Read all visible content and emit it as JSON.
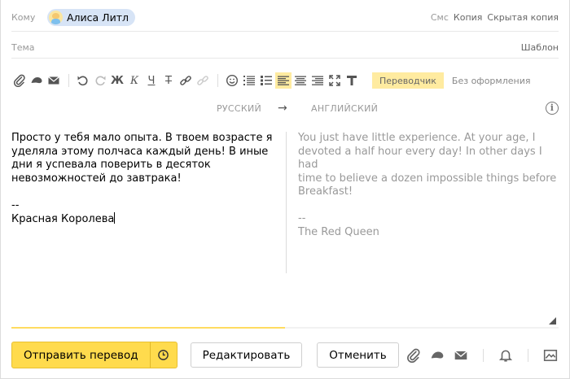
{
  "recipients": {
    "to_label": "Кому",
    "recipient_name": "Алиса Литл",
    "sms": "Смс",
    "cc": "Копия",
    "bcc": "Скрытая копия"
  },
  "subject": {
    "label": "Тема",
    "template_link": "Шаблон"
  },
  "toolbar": {
    "bold": "Ж",
    "italic": "К",
    "underline": "Ч",
    "strike": "Т",
    "translator": "Переводчик",
    "no_format": "Без оформления"
  },
  "translation": {
    "source_lang": "РУССКИЙ",
    "arrow": "→",
    "target_lang": "АНГЛИЙСКИЙ",
    "info": "i",
    "source_text": "Просто у тебя мало опыта. В твоем возрасте я\nуделяла этому полчаса каждый день! В иные\nдни я успевала поверить в десяток\nневозможностей до завтрака!\n\n--\nКрасная Королева",
    "target_text": "You just have little experience. At your age, I\ndevoted a half hour every day! In other days I had\ntime to believe a dozen impossible things before\nBreakfast!\n\n--\nThe Red Queen",
    "progress": 0.5
  },
  "actions": {
    "send": "Отправить перевод",
    "edit": "Редактировать",
    "cancel": "Отменить"
  },
  "colors": {
    "accent": "#ffdb4d",
    "chip": "#d7e4f6",
    "active_tool": "#ffeba0"
  }
}
